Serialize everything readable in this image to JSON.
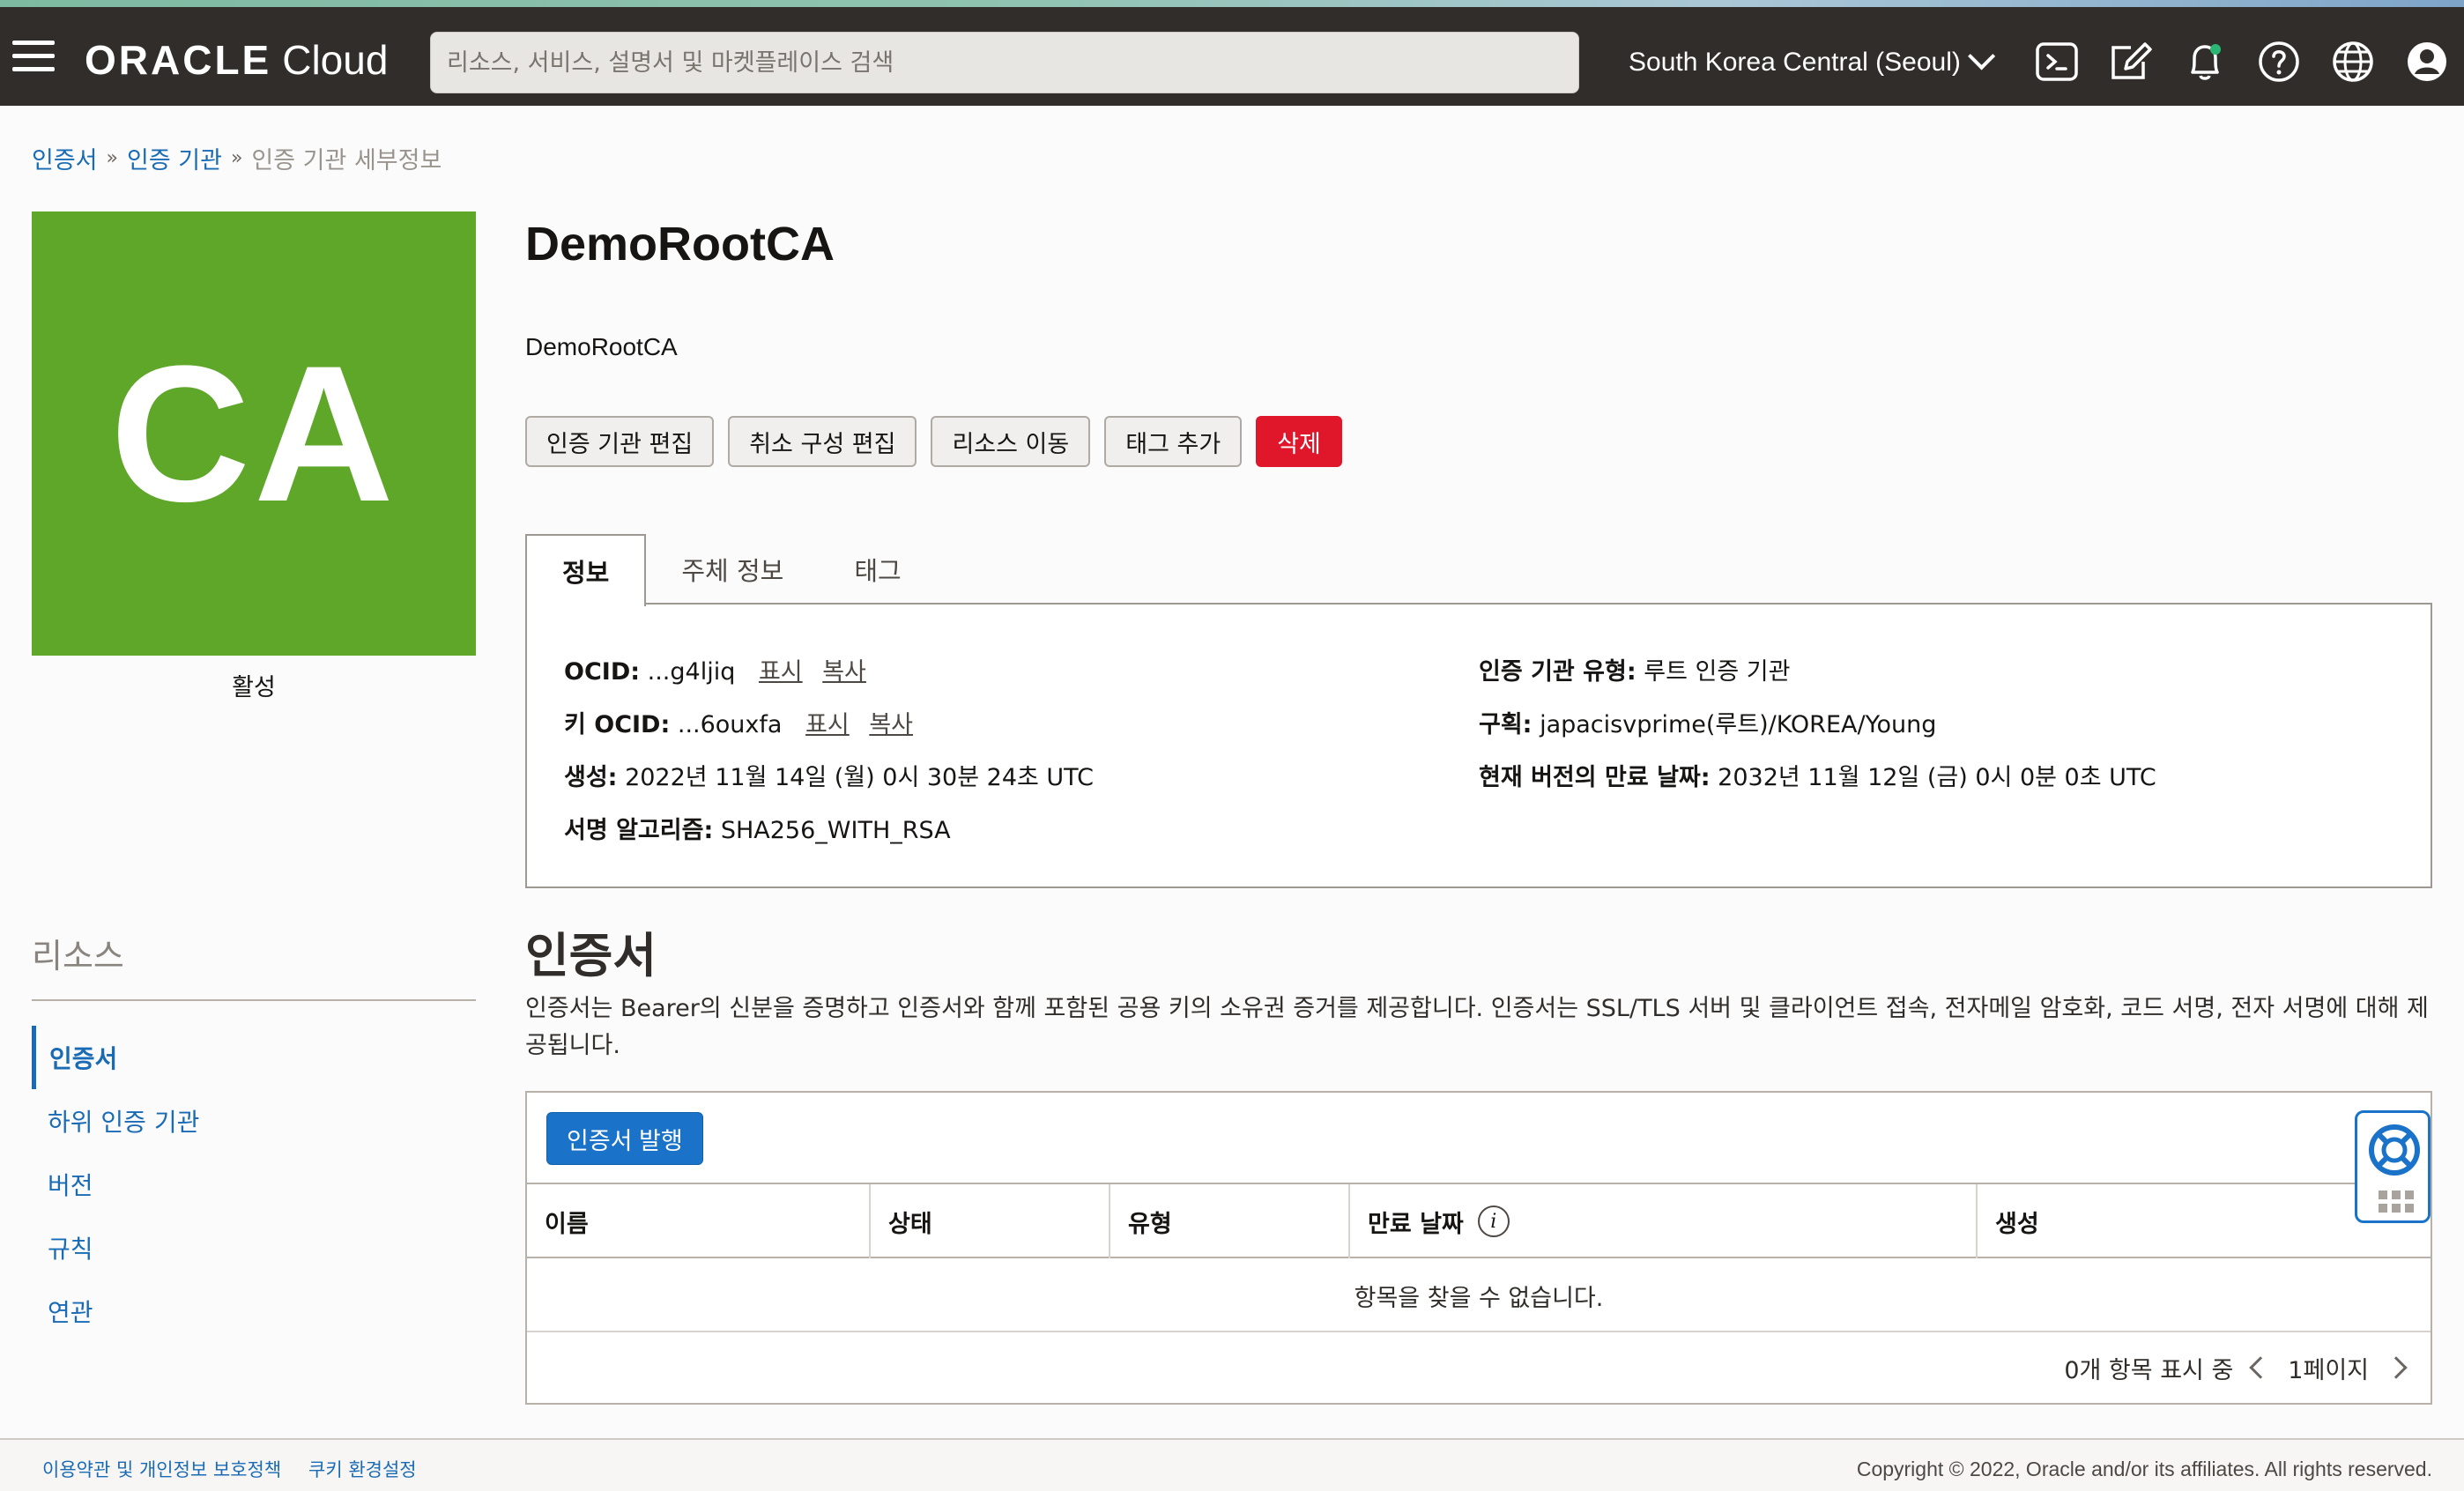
{
  "topbar": {
    "brand_oracle": "ORACLE",
    "brand_cloud": "Cloud",
    "search_placeholder": "리소스, 서비스, 설명서 및 마켓플레이스 검색",
    "region": "South Korea Central (Seoul)",
    "icons": [
      "menu-icon",
      "cloud-shell-icon",
      "edit-icon",
      "bell-icon",
      "help-icon",
      "globe-icon",
      "user-icon"
    ]
  },
  "breadcrumb": {
    "items": [
      "인증서",
      "인증 기관"
    ],
    "separator": "»",
    "current": "인증 기관 세부정보"
  },
  "badge": {
    "text": "CA",
    "color": "#5ea729",
    "state": "활성"
  },
  "resources": {
    "title": "리소스",
    "items": [
      "인증서",
      "하위 인증 기관",
      "버전",
      "규칙",
      "연관"
    ],
    "active_index": 0
  },
  "detail": {
    "title": "DemoRootCA",
    "description": "DemoRootCA",
    "actions": [
      "인증 기관 편집",
      "취소 구성 편집",
      "리소스 이동",
      "태그 추가"
    ],
    "delete_label": "삭제"
  },
  "tabs": [
    "정보",
    "주체 정보",
    "태그"
  ],
  "info": {
    "show_label": "표시",
    "copy_label": "복사",
    "left": [
      {
        "key": "OCID:",
        "value": "...g4ljiq"
      },
      {
        "key": "키 OCID:",
        "value": "...6ouxfa"
      },
      {
        "key": "생성:",
        "value": "2022년 11월 14일 (월) 0시 30분 24초 UTC"
      },
      {
        "key": "서명 알고리즘:",
        "value": "SHA256_WITH_RSA"
      }
    ],
    "right": [
      {
        "key": "인증 기관 유형:",
        "value": "루트 인증 기관"
      },
      {
        "key": "구획:",
        "value": "japacisvprime(루트)/KOREA/Young"
      },
      {
        "key": "현재 버전의 만료 날짜:",
        "value": "2032년 11월 12일 (금) 0시 0분 0초 UTC"
      }
    ]
  },
  "certificates": {
    "title": "인증서",
    "description": "인증서는 Bearer의 신분을 증명하고 인증서와 함께 포함된 공용 키의 소유권 증거를 제공합니다. 인증서는 SSL/TLS 서버 및 클라이언트 접속, 전자메일 암호화, 코드 서명, 전자 서명에 대해 제공됩니다.",
    "issue_button": "인증서 발행",
    "columns": [
      "이름",
      "상태",
      "유형",
      "만료 날짜",
      "생성"
    ],
    "empty_text": "항목을 찾을 수 없습니다.",
    "count_text": "0개 항목 표시 중",
    "page_text": "1페이지"
  },
  "footer": {
    "terms": "이용약관 및 개인정보 보호정책",
    "cookies": "쿠키 환경설정",
    "copyright": "Copyright © 2022, Oracle and/or its affiliates. All rights reserved."
  },
  "colors": {
    "topbar_bg": "#312d2a",
    "link": "#1a6bb5",
    "primary": "#1a73c8",
    "danger": "#e0162b",
    "badge": "#5ea729"
  }
}
